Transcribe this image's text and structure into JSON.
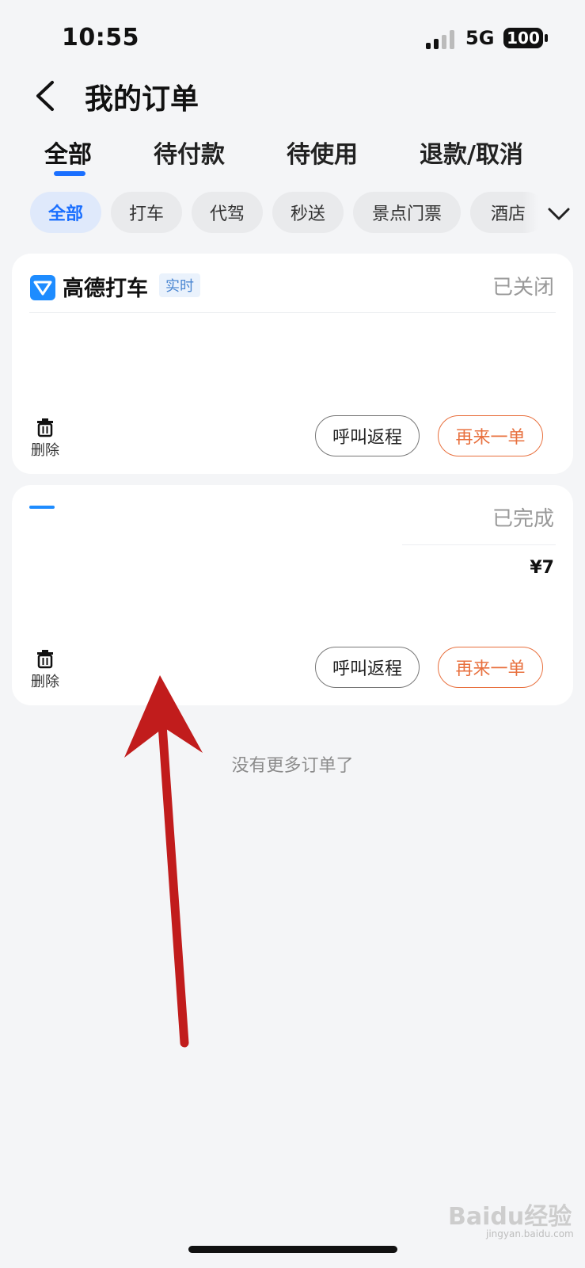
{
  "status_bar": {
    "time": "10:55",
    "network": "5G",
    "battery": "100"
  },
  "header": {
    "title": "我的订单"
  },
  "tabs": [
    {
      "label": "全部",
      "active": true
    },
    {
      "label": "待付款",
      "active": false
    },
    {
      "label": "待使用",
      "active": false
    },
    {
      "label": "退款/取消",
      "active": false
    }
  ],
  "filters": [
    {
      "label": "全部",
      "active": true
    },
    {
      "label": "打车",
      "active": false
    },
    {
      "label": "代驾",
      "active": false
    },
    {
      "label": "秒送",
      "active": false
    },
    {
      "label": "景点门票",
      "active": false
    },
    {
      "label": "酒店",
      "active": false
    }
  ],
  "orders": [
    {
      "service": "高德打车",
      "tag": "实时",
      "status": "已关闭",
      "delete_label": "删除",
      "return_button": "呼叫返程",
      "reorder_button": "再来一单"
    },
    {
      "status": "已完成",
      "price": "¥7",
      "delete_label": "删除",
      "return_button": "呼叫返程",
      "reorder_button": "再来一单"
    }
  ],
  "list_end_text": "没有更多订单了",
  "watermark": {
    "text": "Baidu经验",
    "sub": "jingyan.baidu.com"
  },
  "colors": {
    "accent": "#1a6fff",
    "reorder": "#e8703e",
    "annotation_arrow": "#c11c1c",
    "background": "#f4f5f7"
  }
}
